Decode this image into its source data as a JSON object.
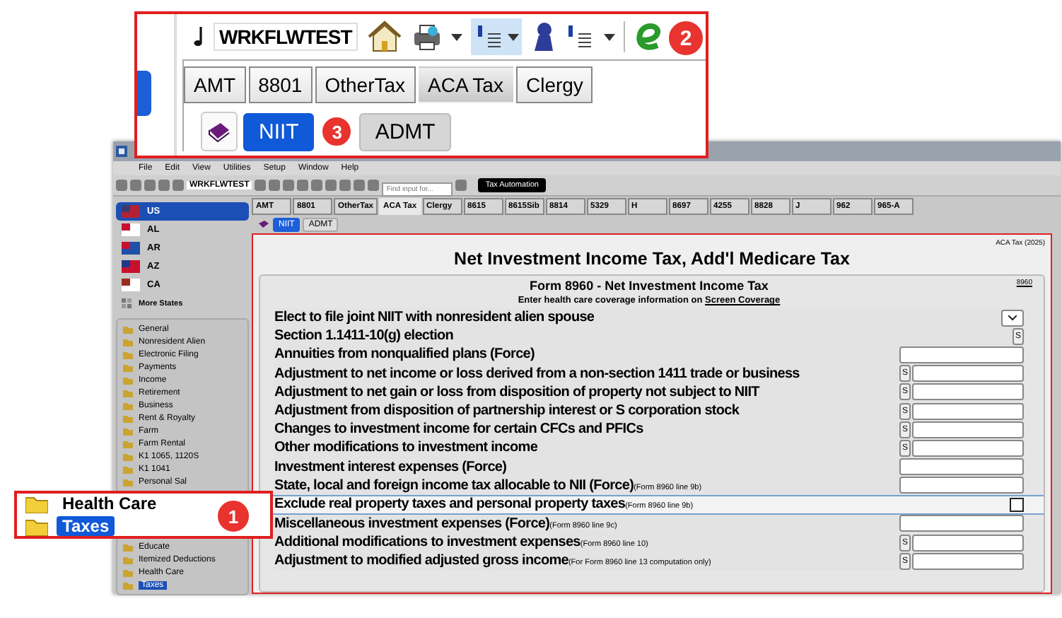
{
  "zoom_top": {
    "client": "WRKFLWTEST",
    "badges": [
      "2",
      "3"
    ],
    "tabs": [
      {
        "label": "AMT",
        "selected": false
      },
      {
        "label": "8801",
        "selected": false
      },
      {
        "label": "OtherTax",
        "selected": false
      },
      {
        "label": "ACA Tax",
        "selected": true
      },
      {
        "label": "Clergy",
        "selected": false
      }
    ],
    "subtabs": [
      {
        "label": "NIIT",
        "selected": true
      },
      {
        "label": "ADMT",
        "selected": false
      }
    ]
  },
  "zoom_sidebar": {
    "badge": "1",
    "items": [
      {
        "label": "Health Care",
        "selected": false
      },
      {
        "label": "Taxes",
        "selected": true
      }
    ]
  },
  "window": {
    "menu": [
      "File",
      "Edit",
      "View",
      "Utilities",
      "Setup",
      "Window",
      "Help"
    ],
    "toolbar": {
      "client": "WRKFLWTEST",
      "search_placeholder": "Find input for...",
      "automation_button": "Tax Automation"
    },
    "states": [
      {
        "kind": "state",
        "label": "US",
        "selected": true
      },
      {
        "kind": "state",
        "label": "AL",
        "selected": false
      },
      {
        "kind": "state",
        "label": "AR",
        "selected": false
      },
      {
        "kind": "state",
        "label": "AZ",
        "selected": false
      },
      {
        "kind": "state",
        "label": "CA",
        "selected": false
      },
      {
        "kind": "more",
        "label": "More States",
        "selected": false
      }
    ],
    "folders_top": [
      {
        "label": "General",
        "selected": false
      },
      {
        "label": "Nonresident Alien",
        "selected": false
      },
      {
        "label": "Electronic Filing",
        "selected": false
      },
      {
        "label": "Payments",
        "selected": false
      },
      {
        "label": "Income",
        "selected": false
      },
      {
        "label": "Retirement",
        "selected": false
      },
      {
        "label": "Business",
        "selected": false
      },
      {
        "label": "Rent & Royalty",
        "selected": false
      },
      {
        "label": "Farm",
        "selected": false
      },
      {
        "label": "Farm Rental",
        "selected": false
      },
      {
        "label": "K1 1065, 1120S",
        "selected": false
      },
      {
        "label": "K1 1041",
        "selected": false
      },
      {
        "label": "Personal Sal",
        "selected": false
      }
    ],
    "folders_bottom": [
      {
        "label": "Educate",
        "selected": false
      },
      {
        "label": "Itemized Deductions",
        "selected": false
      },
      {
        "label": "Health Care",
        "selected": false
      },
      {
        "label": "Taxes",
        "selected": true
      }
    ],
    "form_tabs": [
      {
        "label": "AMT",
        "selected": false
      },
      {
        "label": "8801",
        "selected": false
      },
      {
        "label": "OtherTax",
        "selected": false
      },
      {
        "label": "ACA Tax",
        "selected": true
      },
      {
        "label": "Clergy",
        "selected": false
      },
      {
        "label": "8615",
        "selected": false
      },
      {
        "label": "8615Sib",
        "selected": false
      },
      {
        "label": "8814",
        "selected": false
      },
      {
        "label": "5329",
        "selected": false
      },
      {
        "label": "H",
        "selected": false
      },
      {
        "label": "8697",
        "selected": false
      },
      {
        "label": "4255",
        "selected": false
      },
      {
        "label": "8828",
        "selected": false
      },
      {
        "label": "J",
        "selected": false
      },
      {
        "label": "962",
        "selected": false
      },
      {
        "label": "965-A",
        "selected": false
      }
    ],
    "sub_tabs": [
      {
        "label": "NIIT",
        "selected": true
      },
      {
        "label": "ADMT",
        "selected": false
      }
    ],
    "form": {
      "screen_label": "ACA Tax (2025)",
      "title": "Net Investment Income Tax, Add'l Medicare Tax",
      "section_title": "Form 8960 - Net Investment Income Tax",
      "section_link": "8960",
      "note": "Enter health care coverage information on",
      "note_link": "Screen Coverage",
      "rows": [
        {
          "kind": "dropdown",
          "label": "Elect to file joint NIIT with nonresident alien spouse",
          "highlighted": false
        },
        {
          "kind": "s_button",
          "s_label": "S",
          "label": "Section 1.1411-10(g) election",
          "highlighted": false
        },
        {
          "kind": "input",
          "label": "Annuities from nonqualified plans (Force)",
          "highlighted": false
        },
        {
          "kind": "s_input",
          "s_label": "S",
          "label": "Adjustment to net income or loss derived from a non-section 1411 trade or business",
          "highlighted": false
        },
        {
          "kind": "s_input",
          "s_label": "S",
          "label": "Adjustment to net gain or loss from disposition of property not subject to NIIT",
          "highlighted": false
        },
        {
          "kind": "s_input",
          "s_label": "S",
          "label": "Adjustment from disposition of partnership interest or S corporation stock",
          "highlighted": false
        },
        {
          "kind": "s_input",
          "s_label": "S",
          "label": "Changes to investment income for certain CFCs and PFICs",
          "highlighted": false
        },
        {
          "kind": "s_input",
          "s_label": "S",
          "label": "Other modifications to investment income",
          "highlighted": false
        },
        {
          "kind": "input",
          "label": "Investment interest expenses (Force)",
          "highlighted": false
        },
        {
          "kind": "input",
          "label": "State, local and foreign income tax allocable to NII (Force)",
          "ref": "(Form 8960 line 9b)",
          "highlighted": false
        },
        {
          "kind": "checkbox",
          "label": "Exclude real property taxes and personal property taxes",
          "ref": "(Form 8960 line 9b)",
          "highlighted": true,
          "checked": false
        },
        {
          "kind": "input",
          "label": "Miscellaneous investment expenses (Force)",
          "ref": "(Form 8960 line 9c)",
          "highlighted": false
        },
        {
          "kind": "s_input",
          "s_label": "S",
          "label": "Additional modifications to investment expenses",
          "ref": "(Form 8960 line 10)",
          "highlighted": false
        },
        {
          "kind": "s_input",
          "s_label": "S",
          "label": "Adjustment to modified adjusted gross income",
          "ref": "(For Form 8960 line 13 computation only)",
          "highlighted": false
        }
      ]
    }
  }
}
